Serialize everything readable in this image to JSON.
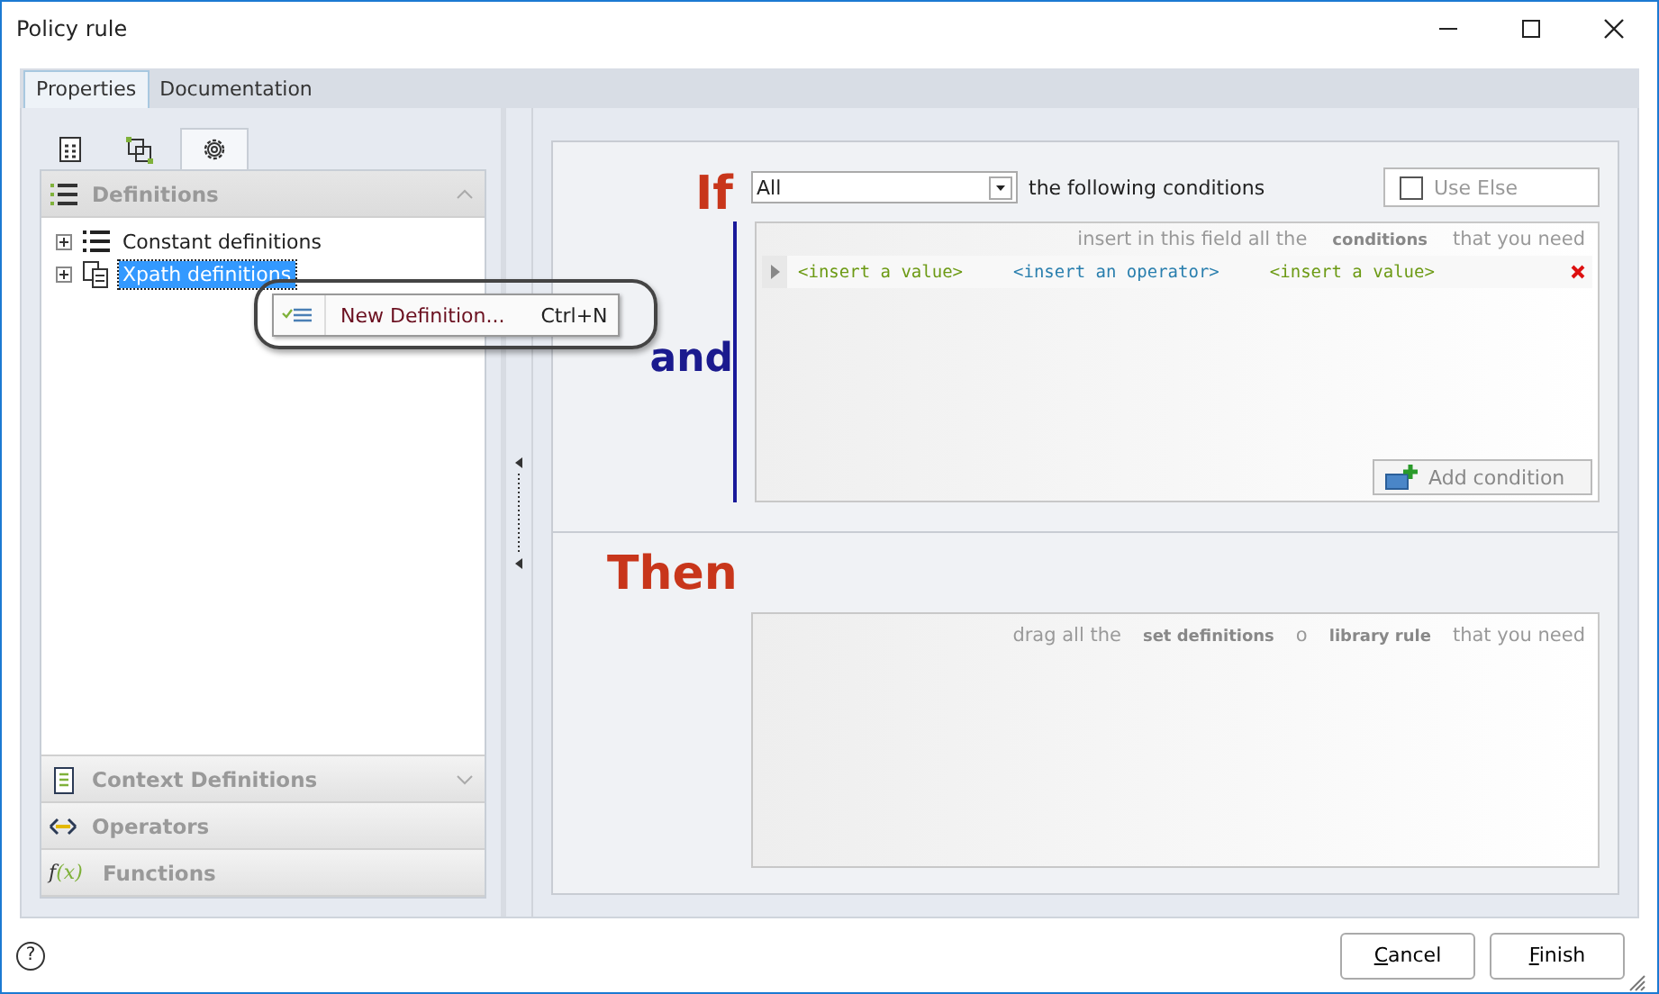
{
  "window": {
    "title": "Policy rule"
  },
  "tabs": [
    {
      "label": "Properties",
      "selected": true
    },
    {
      "label": "Documentation",
      "selected": false
    }
  ],
  "side_tabs": [
    {
      "selected": false
    },
    {
      "selected": false
    },
    {
      "selected": true
    }
  ],
  "accordion": [
    {
      "label": "Definitions",
      "expanded": true
    },
    {
      "label": "Context Definitions",
      "expanded": false
    },
    {
      "label": "Operators",
      "expanded": false
    },
    {
      "label": "Functions",
      "expanded": false,
      "icon_text": [
        "f",
        "(x)"
      ]
    }
  ],
  "tree": [
    {
      "label": "Constant definitions",
      "selected": false
    },
    {
      "label": "Xpath definitions",
      "selected": true
    }
  ],
  "context_menu": {
    "label": "New Definition...",
    "shortcut": "Ctrl+N"
  },
  "if_section": {
    "keyword": "If",
    "match": {
      "value": "All"
    },
    "match_label": "the following conditions",
    "use_else": {
      "label": "Use Else",
      "checked": false
    },
    "joiner": "and",
    "hint": [
      {
        "text": "insert in this field all the",
        "kind": "plain"
      },
      {
        "text": "conditions",
        "kind": "term"
      },
      {
        "text": "that you need",
        "kind": "plain"
      }
    ],
    "condition": [
      {
        "text": "<insert a value>",
        "kind": "value"
      },
      {
        "text": "<insert an operator>",
        "kind": "operator"
      },
      {
        "text": "<insert a value>",
        "kind": "value"
      }
    ],
    "add_button": "Add condition"
  },
  "then_section": {
    "keyword": "Then",
    "hint": [
      {
        "text": "drag all the",
        "kind": "plain"
      },
      {
        "text": "set definitions",
        "kind": "term"
      },
      {
        "text": "o",
        "kind": "plain"
      },
      {
        "text": "library rule",
        "kind": "term"
      },
      {
        "text": "that you need",
        "kind": "plain"
      }
    ]
  },
  "help": "?",
  "buttons": [
    "Cancel",
    "Finish"
  ]
}
